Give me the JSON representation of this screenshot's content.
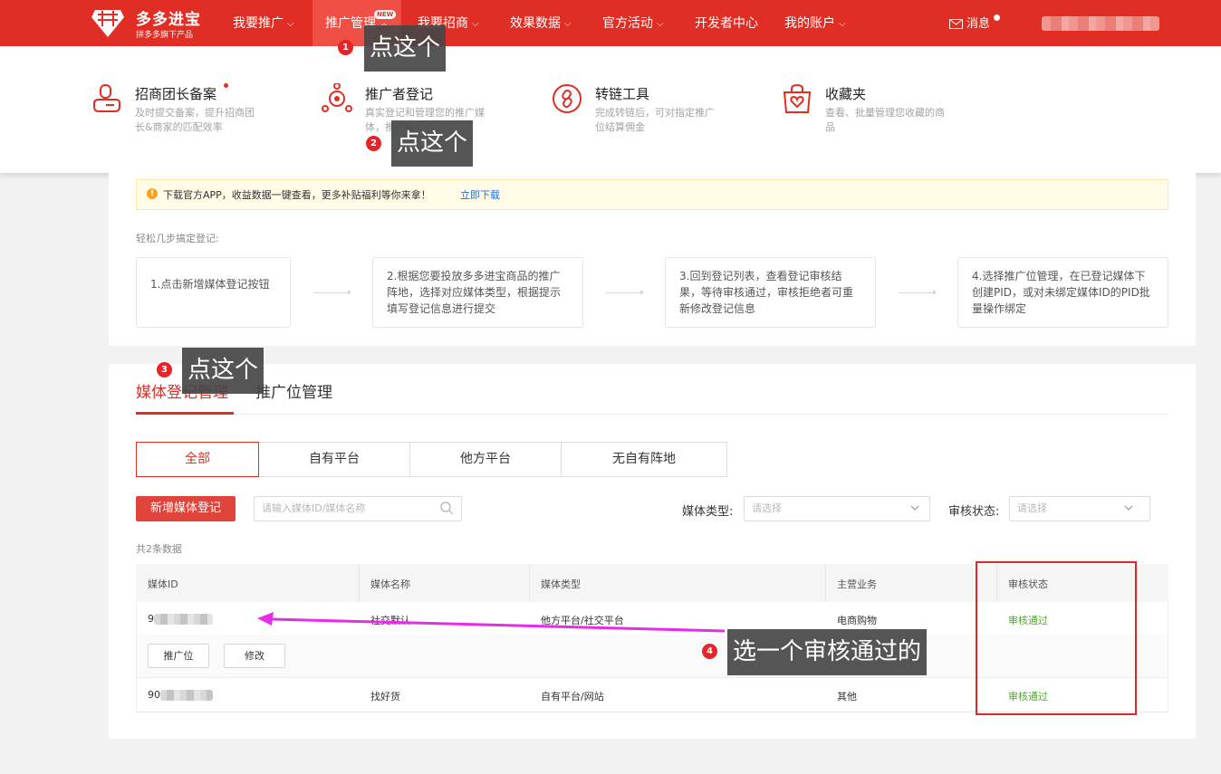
{
  "brand": {
    "title": "多多进宝",
    "subtitle": "拼多多旗下产品"
  },
  "nav": {
    "items": [
      {
        "label": "我要推广",
        "chevron": "v"
      },
      {
        "label": "推广管理",
        "chevron": "^"
      },
      {
        "label": "我要招商",
        "chevron": "v"
      },
      {
        "label": "效果数据",
        "chevron": "v"
      },
      {
        "label": "官方活动",
        "chevron": "v"
      },
      {
        "label": "开发者中心",
        "chevron": ""
      },
      {
        "label": "我的账户",
        "chevron": "v"
      }
    ],
    "new_badge": "NEW",
    "messages": "消息"
  },
  "dropdown": {
    "items": [
      {
        "title": "招商团长备案",
        "desc": "及时提交备案，提升招商团长&商家的匹配效率",
        "icon": "user-badge-icon"
      },
      {
        "title": "推广者登记",
        "desc": "真实登记和管理您的推广媒体，推广位",
        "icon": "network-icon"
      },
      {
        "title": "转链工具",
        "desc": "完成转链后，可对指定推广位结算佣金",
        "icon": "link-icon"
      },
      {
        "title": "收藏夹",
        "desc": "查看、批量管理您收藏的商品",
        "icon": "heart-bag-icon"
      }
    ]
  },
  "notice": {
    "icon": "!",
    "text": "下载官方APP，收益数据一键查看，更多补贴福利等你来拿！",
    "link": "立即下载"
  },
  "steps": {
    "intro": "轻松几步搞定登记:",
    "items": [
      "1.点击新增媒体登记按钮",
      "2.根据您要投放多多进宝商品的推广阵地，选择对应媒体类型，根据提示填写登记信息进行提交",
      "3.回到登记列表，查看登记审核结果，等待审核通过，审核拒绝者可重新修改登记信息",
      "4.选择推广位管理，在已登记媒体下创建PID，或对未绑定媒体ID的PID批量操作绑定"
    ]
  },
  "tabs": {
    "media": "媒体登记管理",
    "pid": "推广位管理"
  },
  "segments": [
    "全部",
    "自有平台",
    "他方平台",
    "无自有阵地"
  ],
  "toolbar": {
    "add_button": "新增媒体登记",
    "search_placeholder": "请输入媒体ID/媒体名称",
    "media_type_label": "媒体类型:",
    "media_type_placeholder": "请选择",
    "review_label": "审核状态:",
    "review_placeholder": "请选择"
  },
  "count_text": "共2条数据",
  "table": {
    "headers": [
      "媒体ID",
      "媒体名称",
      "媒体类型",
      "主营业务",
      "审核状态"
    ],
    "rows": [
      {
        "id_prefix": "9",
        "name": "社交默认",
        "type": "他方平台/社交平台",
        "business": "电商购物",
        "status": "审核通过"
      },
      {
        "id_prefix": "90",
        "name": "找好货",
        "type": "自有平台/网站",
        "business": "其他",
        "status": "审核通过"
      }
    ],
    "row_actions": [
      "推广位",
      "修改"
    ]
  },
  "annotations": [
    {
      "num": "1",
      "text": "点这个"
    },
    {
      "num": "2",
      "text": "点这个"
    },
    {
      "num": "3",
      "text": "点这个"
    },
    {
      "num": "4",
      "text": "选一个审核通过的"
    }
  ],
  "colors": {
    "brand": "#e02e24",
    "success": "#52a832",
    "arrow": "#e52ce8"
  }
}
